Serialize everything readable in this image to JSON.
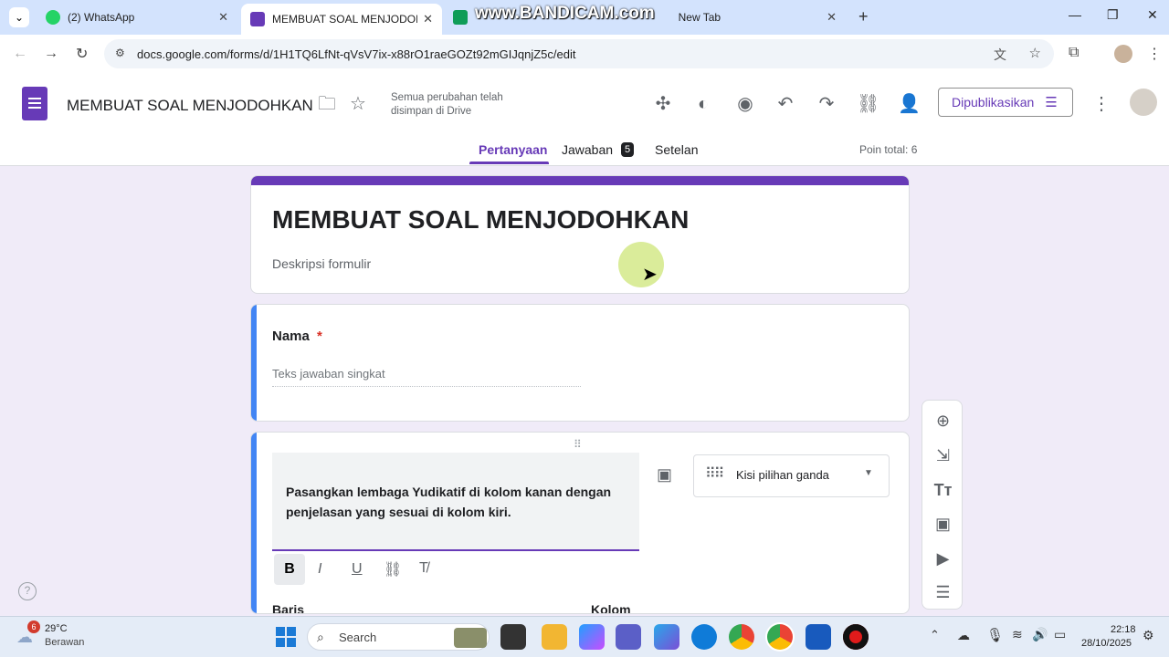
{
  "browser": {
    "tabs": [
      {
        "title": "(2) WhatsApp",
        "color": "#25d366"
      },
      {
        "title": "MEMBUAT SOAL MENJODOHKAN",
        "color": "#673ab7"
      },
      {
        "title": "New Tab",
        "color": "#0f9d58"
      }
    ],
    "watermark": "www.BANDICAM.com",
    "url": "docs.google.com/forms/d/1H1TQ6LfNt-qVsV7ix-x88rO1raeGOZt92mGIJqnjZ5c/edit"
  },
  "forms": {
    "doc_title": "MEMBUAT SOAL MENJODOHKAN",
    "saved_status": "Semua perubahan telah disimpan di Drive",
    "publish_label": "Dipublikasikan",
    "tabs": [
      "Pertanyaan",
      "Jawaban",
      "Setelan"
    ],
    "responses_badge": "5",
    "points_total": "Poin total: 6",
    "header_card": {
      "title": "MEMBUAT SOAL MENJODOHKAN",
      "description": "Deskripsi formulir"
    },
    "question_name": {
      "label": "Nama",
      "required_mark": "*",
      "placeholder": "Teks jawaban singkat"
    },
    "question_match": {
      "text": "Pasangkan lembaga Yudikatif di kolom kanan dengan penjelasan yang sesuai di kolom kiri.",
      "type_label": "Kisi pilihan ganda",
      "row_header": "Baris",
      "col_header": "Kolom"
    }
  },
  "taskbar": {
    "weather_temp": "29°C",
    "weather_desc": "Berawan",
    "weather_badge": "6",
    "search_label": "Search",
    "time": "22:18",
    "date": "28/10/2025"
  },
  "colors": {
    "accent": "#673ab7",
    "question_bar": "#4285f4",
    "bg": "#f0ebf8"
  }
}
